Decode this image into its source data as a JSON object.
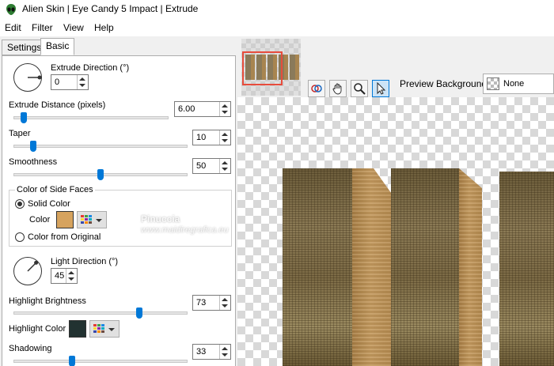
{
  "window": {
    "title": "Alien Skin | Eye Candy 5 Impact | Extrude",
    "icon": "alien-skin-icon"
  },
  "menu": [
    {
      "label": "Edit"
    },
    {
      "label": "Filter"
    },
    {
      "label": "View"
    },
    {
      "label": "Help"
    }
  ],
  "tabs": [
    {
      "label": "Settings",
      "active": false
    },
    {
      "label": "Basic",
      "active": true
    }
  ],
  "basic": {
    "extrude_direction": {
      "label": "Extrude Direction (°)",
      "value": "0",
      "angle_deg": 0
    },
    "extrude_distance": {
      "label": "Extrude Distance (pixels)",
      "value": "6.00",
      "slider_fraction": 0.05
    },
    "taper": {
      "label": "Taper",
      "value": "10",
      "slider_fraction": 0.1
    },
    "smoothness": {
      "label": "Smoothness",
      "value": "50",
      "slider_fraction": 0.5
    },
    "side_faces": {
      "group_label": "Color of Side Faces",
      "solid_color_label": "Solid Color",
      "color_label": "Color",
      "color_value": "#d6a35e",
      "from_original_label": "Color from Original",
      "selected": "solid"
    },
    "light_direction": {
      "label": "Light Direction (°)",
      "value": "45",
      "angle_deg": 45
    },
    "highlight_brightness": {
      "label": "Highlight Brightness",
      "value": "73",
      "slider_fraction": 0.73
    },
    "highlight_color": {
      "label": "Highlight Color",
      "color_value": "#223231"
    },
    "shadowing": {
      "label": "Shadowing",
      "value": "33",
      "slider_fraction": 0.33
    }
  },
  "watermark": {
    "line1": "Pinuccia",
    "line2": "www.maidiregrafica.eu"
  },
  "toolbar": {
    "tools": [
      {
        "name": "compare-tool-icon",
        "active": false
      },
      {
        "name": "hand-tool-icon",
        "active": false
      },
      {
        "name": "zoom-tool-icon",
        "active": false
      },
      {
        "name": "pointer-tool-icon",
        "active": true
      }
    ]
  },
  "preview_background": {
    "label": "Preview Background:",
    "value": "None"
  },
  "colors": {
    "accent": "#0078d7",
    "selection_frame": "#e74c3c"
  }
}
